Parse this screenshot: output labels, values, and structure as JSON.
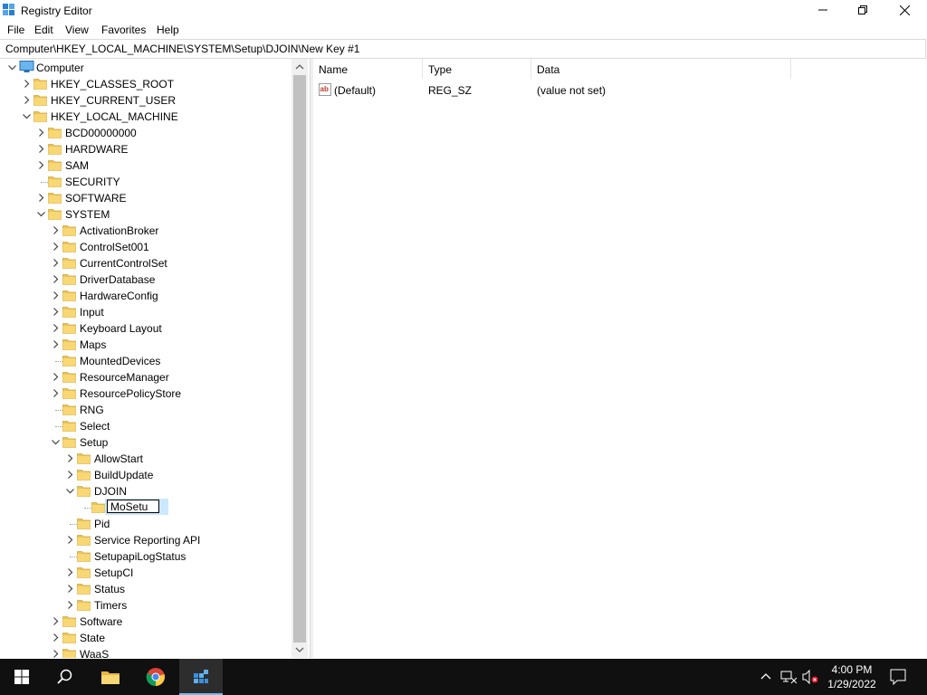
{
  "window": {
    "title": "Registry Editor",
    "controls": [
      "minimize",
      "restore",
      "close"
    ]
  },
  "menu": [
    "File",
    "Edit",
    "View",
    "Favorites",
    "Help"
  ],
  "address": "Computer\\HKEY_LOCAL_MACHINE\\SYSTEM\\Setup\\DJOIN\\New Key #1",
  "tree": {
    "root": "Computer",
    "hives": [
      "HKEY_CLASSES_ROOT",
      "HKEY_CURRENT_USER",
      "HKEY_LOCAL_MACHINE"
    ],
    "hklm_children": [
      "BCD00000000",
      "HARDWARE",
      "SAM",
      "SECURITY",
      "SOFTWARE",
      "SYSTEM"
    ],
    "system_children": [
      "ActivationBroker",
      "ControlSet001",
      "CurrentControlSet",
      "DriverDatabase",
      "HardwareConfig",
      "Input",
      "Keyboard Layout",
      "Maps",
      "MountedDevices",
      "ResourceManager",
      "ResourcePolicyStore",
      "RNG",
      "Select",
      "Setup"
    ],
    "setup_children": [
      "AllowStart",
      "BuildUpdate",
      "DJOIN"
    ],
    "rename_value": "MoSetu",
    "setup_children_after": [
      "Pid",
      "Service Reporting API",
      "SetupapiLogStatus",
      "SetupCI",
      "Status",
      "Timers"
    ],
    "system_children_after": [
      "Software",
      "State",
      "WaaS"
    ]
  },
  "values": {
    "headers": [
      "Name",
      "Type",
      "Data"
    ],
    "rows": [
      {
        "name": "(Default)",
        "type": "REG_SZ",
        "data": "(value not set)",
        "icon": "string-value-icon"
      }
    ]
  },
  "taskbar": {
    "apps": [
      "start-icon",
      "search-icon",
      "file-explorer-icon",
      "chrome-icon",
      "registry-editor-icon"
    ],
    "time": "4:00 PM",
    "date": "1/29/2022"
  },
  "colors": {
    "folder": "#f8d775",
    "selection": "#cce8ff",
    "taskbar": "#101010",
    "active_indicator": "#76b9ed"
  }
}
